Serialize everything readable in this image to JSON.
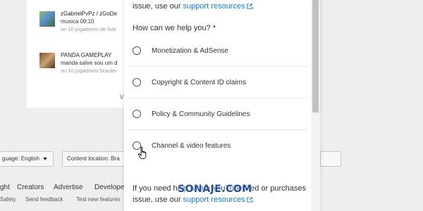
{
  "background": {
    "comments": [
      {
        "author": "zGabrielPvPz / zGoDe",
        "message": "musica 09:10",
        "meta": "on 10 jogadores de fute"
      },
      {
        "author": "PANDA GAMEPLAY",
        "message": "manda salve sou um d",
        "meta": "on 10 jogadores brasilei"
      }
    ],
    "view_more_fragment": "V",
    "footer": {
      "language_select": "guage: English",
      "location_select": "Content location: Bra",
      "nav": [
        "ght",
        "Creators",
        "Advertise",
        "Develope"
      ],
      "sub_links": [
        "Safety",
        "Send feedback",
        "Test new features"
      ]
    }
  },
  "dialog": {
    "intro_prefix": "issue, use our",
    "intro_link": "support resources",
    "intro_suffix": ".",
    "question": "How can we help you? *",
    "options": [
      {
        "label": "Monetization & AdSense"
      },
      {
        "label": "Copyright & Content ID claims"
      },
      {
        "label": "Policy & Community Guidelines"
      },
      {
        "label": "Channel & video features"
      }
    ],
    "outro_line1": "If you need help with a YouTube Red or purchases",
    "outro_prefix": "issue, use our",
    "outro_link": "support resources",
    "outro_suffix": "."
  },
  "watermark": "SONAJE.COM",
  "colors": {
    "link": "#167ac6",
    "watermark": "#1d4f9c",
    "text": "#333333"
  },
  "icons": {
    "external_link": "external-link-icon",
    "cursor": "hand-pointer-cursor"
  }
}
